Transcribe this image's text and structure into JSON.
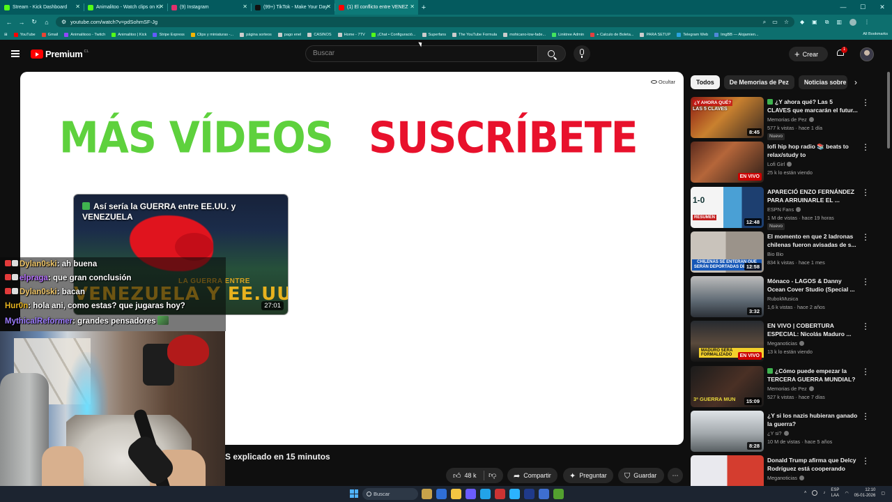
{
  "browser": {
    "tabs": [
      {
        "title": "Stream - Kick Dashboard",
        "favicon_color": "#53fc18"
      },
      {
        "title": "Animalitoo - Watch clips on Ki",
        "favicon_color": "#53fc18"
      },
      {
        "title": "(9) Instagram",
        "favicon_color": "#e1306c"
      },
      {
        "title": "(99+) TikTok - Make Your Day",
        "favicon_color": "#111111"
      },
      {
        "title": "(1) El conflicto entre VENEZ",
        "favicon_color": "#ff0000",
        "active": true
      }
    ],
    "new_tab": "+",
    "url": "youtube.com/watch?v=pdSohmSF-Jg",
    "bookmarks": [
      {
        "label": "YouTube",
        "color": "#ff0000"
      },
      {
        "label": "Gmail",
        "color": "#ea4335"
      },
      {
        "label": "Animalitooo - Twitch",
        "color": "#9146ff"
      },
      {
        "label": "Animalitoo | Kick",
        "color": "#53fc18"
      },
      {
        "label": "Stripe Express",
        "color": "#635bff"
      },
      {
        "label": "Clips y miniaturas -...",
        "color": "#f4b400"
      },
      {
        "label": "página sorteos",
        "color": "#cccccc"
      },
      {
        "label": "pago enel",
        "color": "#cccccc"
      },
      {
        "label": "CASINOS",
        "color": "#cccccc"
      },
      {
        "label": "Home - 7TV",
        "color": "#cccccc"
      },
      {
        "label": "¡Chat • Configuració...",
        "color": "#53fc18"
      },
      {
        "label": "Superfans",
        "color": "#cccccc"
      },
      {
        "label": "The YouTube Formula",
        "color": "#cccccc"
      },
      {
        "label": "mohicano-low-fade...",
        "color": "#cccccc"
      },
      {
        "label": "Linktree Admin",
        "color": "#43e55e"
      },
      {
        "label": "+ Calculo de Boleta...",
        "color": "#e34040"
      },
      {
        "label": "PARA SETUP",
        "color": "#cccccc"
      },
      {
        "label": "Telegram Web",
        "color": "#2aa3df"
      },
      {
        "label": "ImgBB — Alojamien...",
        "color": "#4f88d9"
      }
    ],
    "all_bookmarks": "All Bookmarks"
  },
  "youtube": {
    "brand": "Premium",
    "country": "CL",
    "search_placeholder": "Buscar",
    "create_label": "Crear",
    "notification_count": "1"
  },
  "player": {
    "hide_label": "Ocultar",
    "endcard_more_videos": "MÁS VÍDEOS",
    "endcard_subscribe": "SUSCRÍBETE",
    "endcard_video": {
      "title": "Así sería la GUERRA entre EE.UU. y VENEZUELA",
      "overlay_caption": "LA GUERRA ENTRE",
      "overlay_big": "VENEZUELA Y EE.UU",
      "duration": "27:01"
    }
  },
  "chat": [
    {
      "user": "Dylan0ski",
      "user_color": "#f2c86a",
      "message": "ah buena",
      "badges": 2
    },
    {
      "user": "elpraga",
      "user_color": "#b873ff",
      "message": "que gran conclusión",
      "badges": 2
    },
    {
      "user": "Dylan0ski",
      "user_color": "#f2c86a",
      "message": "bacan",
      "badges": 2
    },
    {
      "user": "Hur0n",
      "user_color": "#e8b521",
      "message": "hola ani, como estas? que jugaras hoy?",
      "badges": 0
    },
    {
      "user": "MythicalReformer",
      "user_color": "#9c7bff",
      "message": "grandes pensadores",
      "badges": 0
    }
  ],
  "video": {
    "title_visible": "S explicado en 15 minutos",
    "likes": "48 k",
    "share": "Compartir",
    "ask": "Preguntar",
    "save": "Guardar"
  },
  "sidebar": {
    "chips": [
      "Todos",
      "De Memorias de Pez",
      "Noticias sobre p"
    ],
    "recommendations": [
      {
        "title": "¿Y ahora qué? Las 5 CLAVES que marcarán el futur...",
        "verified_check": true,
        "channel": "Memorias de Pez",
        "channel_verified": true,
        "meta": "577 k vistas · hace 1 día",
        "duration": "8:45",
        "new": "Nuevo",
        "thumb_text": "¿Y AHORA QUÉ?",
        "thumb_text2": "LAS 5 CLAVES"
      },
      {
        "title": "lofi hip hop radio 📚 beats to relax/study to",
        "channel": "Lofi Girl",
        "channel_verified": true,
        "meta": "25 k lo están viendo",
        "live": "EN VIVO"
      },
      {
        "title": "APARECIÓ ENZO FERNÁNDEZ PARA ARRUINARLE EL ...",
        "channel": "ESPN Fans",
        "channel_verified": true,
        "meta": "1 M de vistas · hace 19 horas",
        "duration": "12:48",
        "new": "Nuevo",
        "thumb_text": "1-0",
        "thumb_text2": "RESUMEN"
      },
      {
        "title": "El momento en que 2 ladronas chilenas fueron avisadas de s...",
        "channel": "Bio Bio",
        "meta": "834 k vistas · hace 1 mes",
        "duration": "12:58",
        "thumb_text": "CHILENAS SE ENTERAN QUE SERÁN DEPORTADAS DE EE.UU"
      },
      {
        "title": "Mónaco - LAGOS & Danny Ocean  Cover Studio (Special ...",
        "channel": "RubokMusica",
        "meta": "1,6 k vistas · hace 2 años",
        "duration": "3:32"
      },
      {
        "title": "EN VIVO | COBERTURA ESPECIAL: Nicolás Maduro ...",
        "channel": "Meganoticias",
        "channel_verified": true,
        "meta": "13 k lo están viendo",
        "live": "EN VIVO",
        "thumb_text": "MADURO SERÁ FORMALIZADO"
      },
      {
        "title": "¿Cómo puede empezar la TERCERA GUERRA MUNDIAL?",
        "verified_check": true,
        "channel": "Memorias de Pez",
        "channel_verified": true,
        "meta": "527 k vistas · hace 7 días",
        "duration": "15:09",
        "thumb_text": "3ª GUERRA MUN"
      },
      {
        "title": "¿Y si los nazis hubieran ganado la guerra?",
        "channel": "¿Y si?",
        "channel_verified": true,
        "meta": "10 M de vistas · hace 5 años",
        "duration": "8:28"
      },
      {
        "title": "Donald Trump afirma que Delcy Rodríguez está cooperando co...",
        "channel": "Meganoticias",
        "channel_verified": true,
        "meta": ""
      }
    ]
  },
  "taskbar": {
    "search": "Buscar",
    "lang": "ESP",
    "lang2": "LAA",
    "time": "12:10",
    "date": "05-01-2026",
    "app_colors": [
      "#c8a24a",
      "#2f6fd6",
      "#f4c542",
      "#6b5cff",
      "#22a3e8",
      "#c33",
      "#2bb3ff",
      "#1f3a8a",
      "#3e6fd1",
      "#53a02f"
    ]
  }
}
